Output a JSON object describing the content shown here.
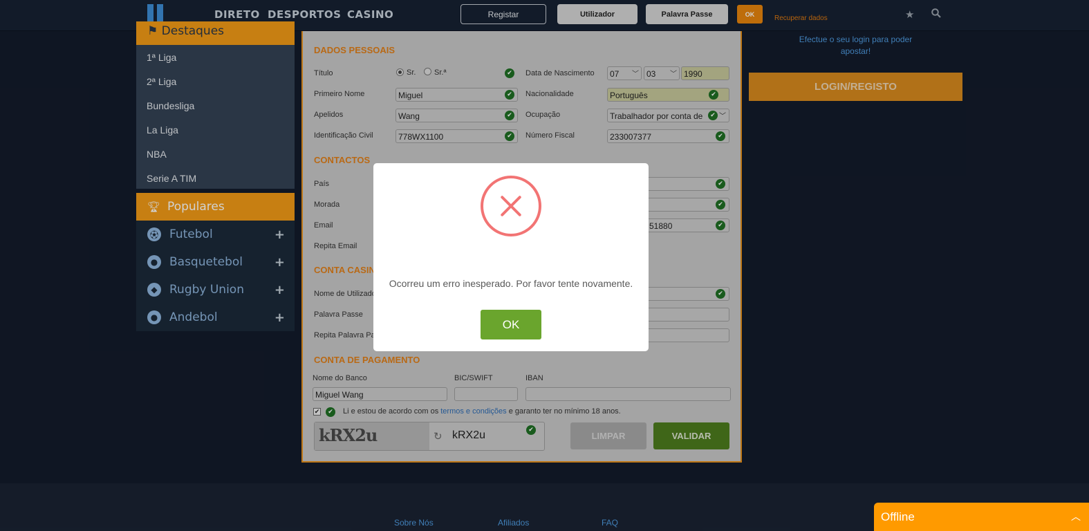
{
  "header": {
    "nav": [
      "DIRETO",
      "DESPORTOS",
      "CASINO"
    ],
    "register_label": "Registar",
    "username_placeholder": "Utilizador",
    "password_placeholder": "Palavra Passe",
    "ok_label": "OK",
    "recover_label": "Recuperar dados",
    "icons": [
      "star-icon",
      "search-icon"
    ]
  },
  "sidebar": {
    "highlights_title": "Destaques",
    "leagues": [
      "1ª Liga",
      "2ª Liga",
      "Bundesliga",
      "La Liga",
      "NBA",
      "Serie A TIM"
    ],
    "popular_title": "Populares",
    "sports": [
      {
        "label": "Futebol",
        "icon": "football-icon"
      },
      {
        "label": "Basquetebol",
        "icon": "basketball-icon"
      },
      {
        "label": "Rugby Union",
        "icon": "rugby-icon"
      },
      {
        "label": "Andebol",
        "icon": "handball-icon"
      }
    ]
  },
  "form": {
    "personal_title": "DADOS PESSOAIS",
    "title_label": "Título",
    "title_options": [
      "Sr.",
      "Sr.ª"
    ],
    "first_name_label": "Primeiro Nome",
    "first_name": "Miguel",
    "last_name_label": "Apelidos",
    "last_name": "Wang",
    "civil_id_label": "Identificação Civil",
    "civil_id": "778WX1100",
    "birth_label": "Data de Nascimento",
    "birth_day": "07",
    "birth_month": "03",
    "birth_year": "1990",
    "nationality_label": "Nacionalidade",
    "nationality": "Português",
    "occupation_label": "Ocupação",
    "occupation": "Trabalhador por conta de",
    "tax_label": "Número Fiscal",
    "tax": "233007377",
    "contacts_title": "CONTACTOS",
    "country_label": "País",
    "address_label": "Morada",
    "email_label": "Email",
    "email_repeat_label": "Repita Email",
    "phone_partial": "51880",
    "casino_title": "CONTA CASINO",
    "username_label": "Nome de Utilizador",
    "password_label": "Palavra Passe",
    "password_repeat_label": "Repita Palavra Passe",
    "payment_title": "CONTA DE PAGAMENTO",
    "bank_label": "Nome do Banco",
    "bank": "Miguel Wang",
    "bic_label": "BIC/SWIFT",
    "iban_label": "IBAN",
    "terms_prefix": "Li e estou de acordo com os ",
    "terms_link": "termos e condições",
    "terms_suffix": " e garanto ter no mínimo 18 anos.",
    "captcha_image_text": "kRX2u",
    "captcha_value": "kRX2u",
    "clear_label": "LIMPAR",
    "validate_label": "VALIDAR"
  },
  "right": {
    "hint": "Efectue o seu login para poder apostar!",
    "login_label": "LOGIN/REGISTO"
  },
  "footer": {
    "links": [
      "Sobre Nós",
      "Afiliados",
      "FAQ"
    ],
    "chat_status": "Offline"
  },
  "modal": {
    "message": "Ocorreu um erro inesperado. Por favor tente novamente.",
    "ok_label": "OK"
  },
  "colors": {
    "accent": "#f39b16",
    "error": "#f27474",
    "success": "#6aa52d",
    "background": "#131b2b"
  }
}
